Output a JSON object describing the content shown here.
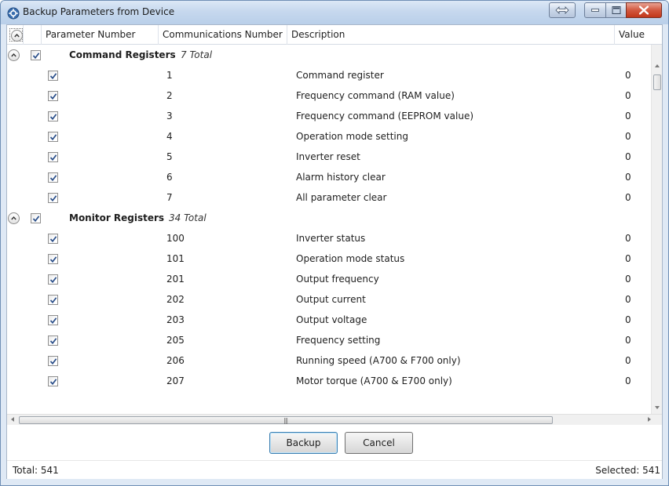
{
  "window": {
    "title": "Backup Parameters from Device",
    "app_icon": "gear-cog-icon",
    "controls": [
      "swap-icon",
      "minimize-icon",
      "maximize-icon",
      "close-icon"
    ]
  },
  "table": {
    "columns": {
      "param": "Parameter Number",
      "comm": "Communications Number",
      "desc": "Description",
      "value": "Value"
    },
    "groups": [
      {
        "name": "Command Registers",
        "total": "7 Total",
        "rows": [
          {
            "comm": "1",
            "desc": "Command register",
            "value": "0"
          },
          {
            "comm": "2",
            "desc": "Frequency command (RAM value)",
            "value": "0"
          },
          {
            "comm": "3",
            "desc": "Frequency command (EEPROM value)",
            "value": "0"
          },
          {
            "comm": "4",
            "desc": "Operation mode setting",
            "value": "0"
          },
          {
            "comm": "5",
            "desc": "Inverter reset",
            "value": "0"
          },
          {
            "comm": "6",
            "desc": "Alarm history clear",
            "value": "0"
          },
          {
            "comm": "7",
            "desc": "All parameter clear",
            "value": "0"
          }
        ]
      },
      {
        "name": "Monitor Registers",
        "total": "34 Total",
        "rows": [
          {
            "comm": "100",
            "desc": "Inverter status",
            "value": "0"
          },
          {
            "comm": "101",
            "desc": "Operation mode status",
            "value": "0"
          },
          {
            "comm": "201",
            "desc": "Output frequency",
            "value": "0"
          },
          {
            "comm": "202",
            "desc": "Output current",
            "value": "0"
          },
          {
            "comm": "203",
            "desc": "Output voltage",
            "value": "0"
          },
          {
            "comm": "205",
            "desc": "Frequency setting",
            "value": "0"
          },
          {
            "comm": "206",
            "desc": "Running speed (A700 & F700 only)",
            "value": "0"
          },
          {
            "comm": "207",
            "desc": "Motor torque (A700 & E700 only)",
            "value": "0"
          }
        ]
      }
    ]
  },
  "buttons": {
    "backup": "Backup",
    "cancel": "Cancel"
  },
  "status": {
    "total": "Total: 541",
    "selected": "Selected: 541"
  },
  "colors": {
    "titlebar": "#c6d8ee",
    "close_button": "#c2371a",
    "default_button_border": "#3c7fb1"
  }
}
